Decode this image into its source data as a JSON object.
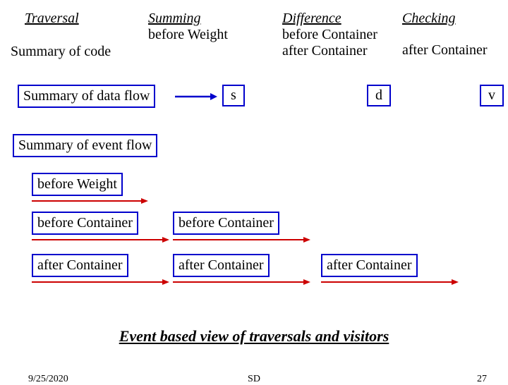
{
  "header": {
    "traversal": "Traversal",
    "summing": "Summing",
    "summing_sub": "before Weight",
    "difference": "Difference",
    "difference_sub1": "before Container",
    "difference_sub2": "after Container",
    "checking": "Checking",
    "checking_sub": "after Container"
  },
  "row1_label": "Summary of code",
  "row2": {
    "label": "Summary of data flow",
    "s": "s",
    "d": "d",
    "v": "v"
  },
  "row3_label": "Summary of event flow",
  "events": {
    "before_weight": "before Weight",
    "before_container1": "before Container",
    "before_container2": "before Container",
    "after_container1": "after Container",
    "after_container2": "after Container",
    "after_container3": "after Container"
  },
  "caption": "Event  based view of traversals and visitors",
  "footer": {
    "date": "9/25/2020",
    "center": "SD",
    "page": "27"
  }
}
